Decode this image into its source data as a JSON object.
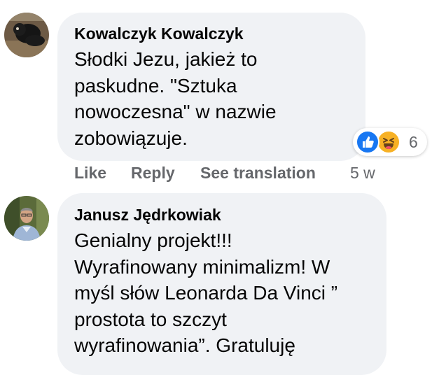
{
  "comments": [
    {
      "author": "Kowalczyk Kowalczyk",
      "text": "Słodki Jezu, jakież to\npaskudne. \"Sztuka\nnowoczesna\" w nazwie\nzobowiązuje.",
      "reactions": {
        "icons": [
          "like-icon",
          "haha-icon"
        ],
        "count": "6"
      },
      "actions": {
        "like": "Like",
        "reply": "Reply",
        "see_translation": "See translation",
        "time": "5 w"
      }
    },
    {
      "author": "Janusz Jędrkowiak",
      "text": "Genialny projekt!!!\nWyrafinowany minimalizm! W\nmyśl słów Leonarda Da Vinci ”\nprostota to szczyt\nwyrafinowania”. Gratuluję"
    }
  ],
  "colors": {
    "bubble": "#f0f2f5",
    "secondary_text": "#65676b",
    "like_blue": "#1877f2",
    "haha_yellow": "#f7b125"
  }
}
